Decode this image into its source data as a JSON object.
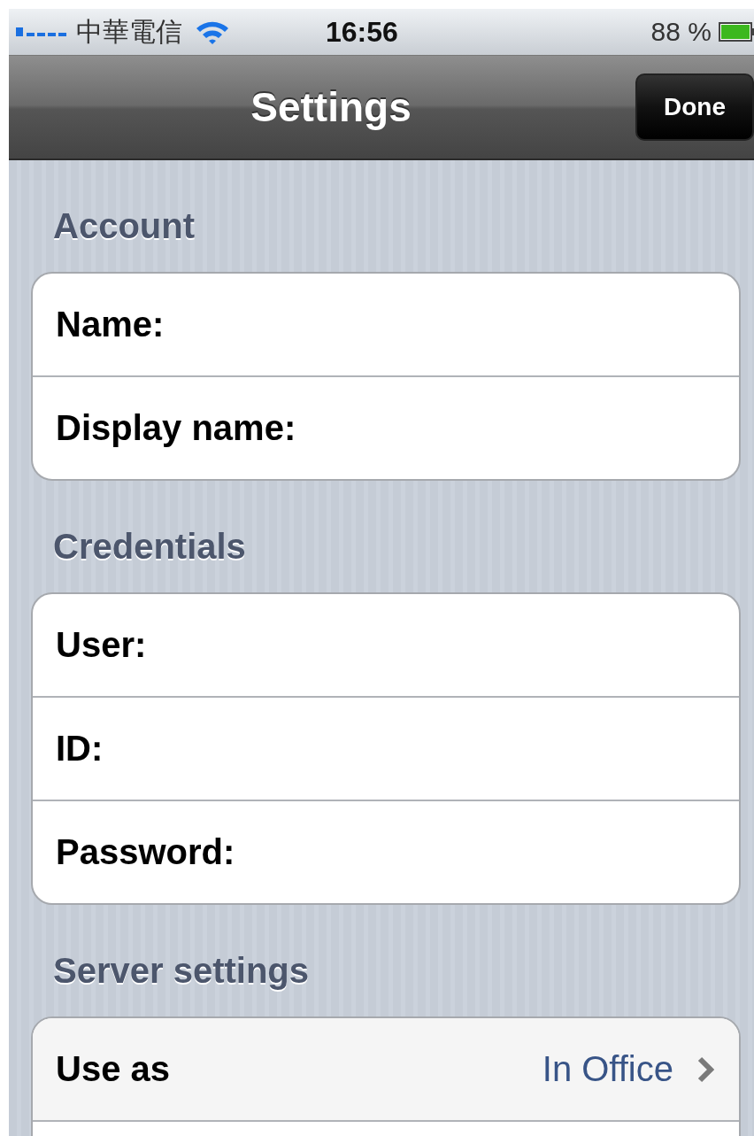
{
  "status_bar": {
    "carrier": "中華電信",
    "time": "16:56",
    "battery": "88 %"
  },
  "nav_bar": {
    "title": "Settings",
    "done_button": "Done"
  },
  "sections": [
    {
      "header": "Account",
      "rows": [
        {
          "kind": "field",
          "label": "Name:"
        },
        {
          "kind": "field",
          "label": "Display name:"
        }
      ]
    },
    {
      "header": "Credentials",
      "rows": [
        {
          "kind": "field",
          "label": "User:"
        },
        {
          "kind": "field",
          "label": "ID:"
        },
        {
          "kind": "field",
          "label": "Password:"
        }
      ]
    },
    {
      "header": "Server settings",
      "rows": [
        {
          "kind": "disclosure",
          "label": "Use as",
          "value": "In Office"
        },
        {
          "kind": "blank"
        }
      ]
    }
  ]
}
